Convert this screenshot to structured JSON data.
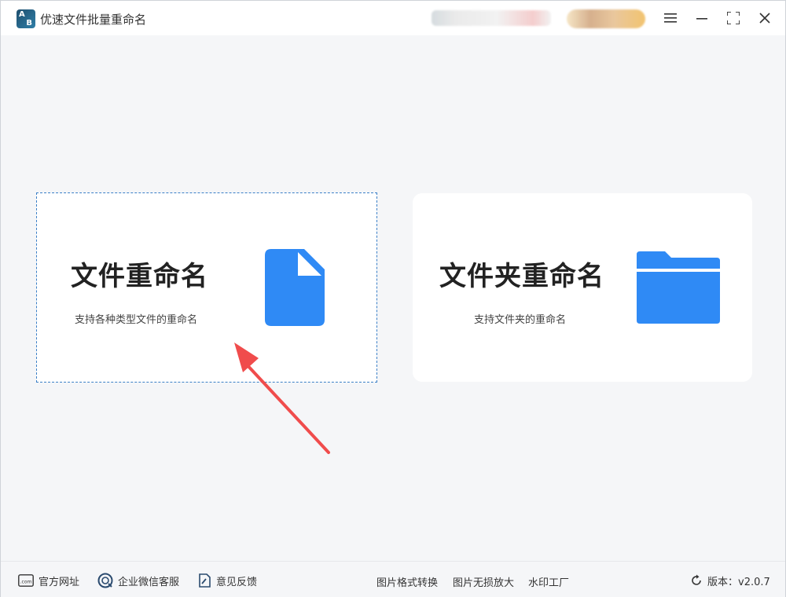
{
  "window": {
    "title": "优速文件批量重命名",
    "logo_letters": [
      "A",
      "B"
    ]
  },
  "cards": {
    "file": {
      "title": "文件重命名",
      "desc": "支持各种类型文件的重命名",
      "icon": "file-icon",
      "icon_color": "#2f8af5"
    },
    "folder": {
      "title": "文件夹重命名",
      "desc": "支持文件夹的重命名",
      "icon": "folder-icon",
      "icon_color": "#2f8af5"
    }
  },
  "footer": {
    "website": "官方网址",
    "wechat_service": "企业微信客服",
    "feedback": "意见反馈",
    "links": [
      "图片格式转换",
      "图片无损放大",
      "水印工厂"
    ],
    "version": "版本：v2.0.7",
    "com_label": ".com"
  },
  "colors": {
    "accent": "#2f8af5",
    "arrow": "#f04c4c"
  }
}
